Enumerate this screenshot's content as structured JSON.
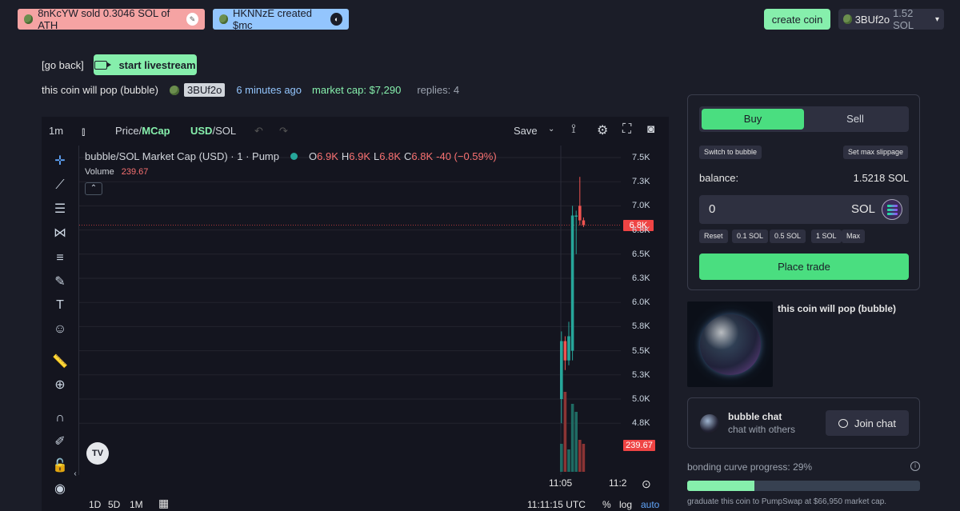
{
  "tickers": [
    {
      "text": "8nKcYW sold 0.3046 SOL of ATH",
      "color": "#f5a3a3"
    },
    {
      "text": "HKNNzE created $mc",
      "color": "#93c5fd"
    }
  ],
  "header": {
    "create_coin": "create coin",
    "wallet_name": "3BUf2o",
    "wallet_balance": "1.52 SOL",
    "caret": "▾"
  },
  "nav": {
    "go_back": "[go back]",
    "livestream": "start livestream"
  },
  "coin_info": {
    "name": "this coin will pop (bubble)",
    "creator": "3BUf2o",
    "age": "6 minutes ago",
    "market_cap": "market cap: $7,290",
    "replies": "replies: 4"
  },
  "chart_toolbar": {
    "interval": "1m",
    "price_label": "Price/",
    "mcap_label": "MCap",
    "usd_label": "USD",
    "sol_label": "/SOL",
    "save": "Save"
  },
  "chart_legend": {
    "title": "bubble/SOL Market Cap (USD) · 1 · Pump",
    "o_key": "O",
    "o_val": "6.9K",
    "h_key": "H",
    "h_val": "6.9K",
    "l_key": "L",
    "l_val": "6.8K",
    "c_key": "C",
    "c_val": "6.8K",
    "change": "-40 (−0.59%)",
    "volume_label": "Volume",
    "volume_val": "239.67"
  },
  "chart_data": {
    "type": "candlestick",
    "y_ticks": [
      "7.5K",
      "7.3K",
      "7.0K",
      "6.8K",
      "6.5K",
      "6.3K",
      "6.0K",
      "5.8K",
      "5.5K",
      "5.3K",
      "5.0K",
      "4.8K"
    ],
    "y_range": [
      4500,
      7600
    ],
    "x_ticks": [
      "11:05",
      "11:2"
    ],
    "current_price_tag": "6.8K",
    "current_volume_tag": "239.67",
    "candles": [
      {
        "o": 5000,
        "h": 5700,
        "l": 4750,
        "c": 5600
      },
      {
        "o": 5600,
        "h": 5650,
        "l": 5300,
        "c": 5400
      },
      {
        "o": 5400,
        "h": 5800,
        "l": 5350,
        "c": 5650
      },
      {
        "o": 5500,
        "h": 7000,
        "l": 5400,
        "c": 6900
      },
      {
        "o": 6900,
        "h": 6950,
        "l": 6500,
        "c": 6900
      },
      {
        "o": 7000,
        "h": 7300,
        "l": 6800,
        "c": 6850
      },
      {
        "o": 6850,
        "h": 6880,
        "l": 6780,
        "c": 6800
      }
    ],
    "volumes": [
      0.35,
      1.0,
      0.28,
      0.85,
      0.75,
      0.4,
      0.35
    ]
  },
  "chart_bottom": {
    "r1d": "1D",
    "r5d": "5D",
    "r1m": "1M",
    "time": "11:11:15 UTC",
    "pct": "%",
    "log": "log",
    "auto": "auto"
  },
  "trade": {
    "buy": "Buy",
    "sell": "Sell",
    "switch": "Switch to bubble",
    "slippage": "Set max slippage",
    "balance_label": "balance:",
    "balance_value": "1.5218 SOL",
    "amount": "0",
    "unit": "SOL",
    "presets": [
      "Reset",
      "0.1 SOL",
      "0.5 SOL",
      "1 SOL",
      "Max"
    ],
    "place": "Place trade"
  },
  "coin_card": {
    "name": "this coin will pop (bubble)"
  },
  "chat": {
    "title": "bubble chat",
    "subtitle": "chat with others",
    "join": "Join chat"
  },
  "bonding": {
    "label": "bonding curve progress: 29%",
    "progress": 0.29,
    "note": "graduate this coin to PumpSwap at $66,950 market cap."
  },
  "tv_logo": "TV"
}
